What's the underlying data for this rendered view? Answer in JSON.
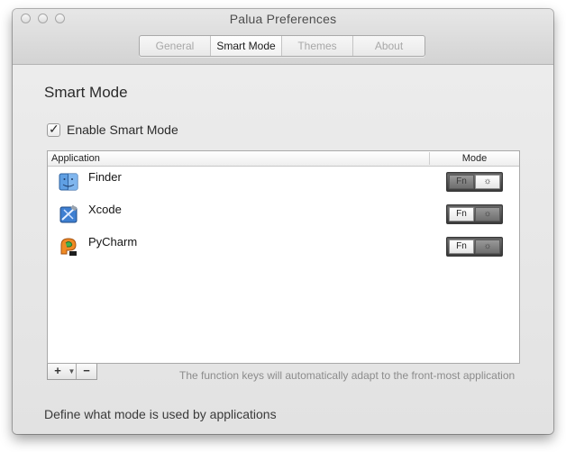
{
  "window": {
    "title": "Palua Preferences"
  },
  "tabs": [
    {
      "label": "General",
      "active": false
    },
    {
      "label": "Smart Mode",
      "active": true
    },
    {
      "label": "Themes",
      "active": false
    },
    {
      "label": "About",
      "active": false
    }
  ],
  "main": {
    "heading": "Smart Mode",
    "enable_label": "Enable Smart Mode",
    "enable_checked": true,
    "table": {
      "columns": [
        "Application",
        "Mode"
      ],
      "rows": [
        {
          "name": "Finder",
          "icon": "finder-icon",
          "mode": "fn",
          "fn_label": "Fn",
          "sun_icon": "brightness-icon"
        },
        {
          "name": "Xcode",
          "icon": "xcode-icon",
          "mode": "media",
          "fn_label": "Fn",
          "sun_icon": "brightness-icon"
        },
        {
          "name": "PyCharm",
          "icon": "pycharm-icon",
          "mode": "media",
          "fn_label": "Fn",
          "sun_icon": "brightness-icon"
        }
      ]
    },
    "buttons": {
      "add": "+",
      "add_menu": "▼",
      "remove": "−"
    },
    "hint": "The function keys will automatically adapt to the front-most application",
    "footer": "Define what mode is used by applications"
  },
  "colors": {
    "window_bg": "#ececec",
    "table_bg": "#ffffff",
    "hint_text": "#8c8c8c"
  }
}
